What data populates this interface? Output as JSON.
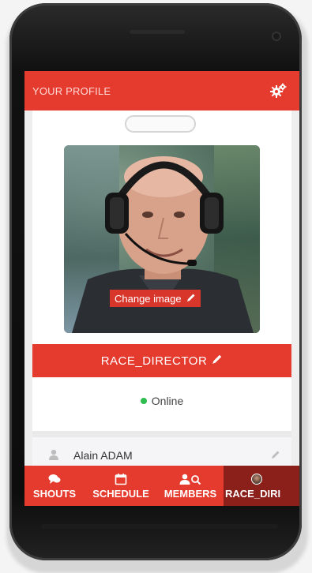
{
  "header": {
    "title": "YOUR PROFILE",
    "settings_icon": "gears-icon"
  },
  "profile": {
    "change_image_label": "Change image",
    "username": "RACE_DIRECTOR",
    "status": "Online",
    "status_color": "#2ebd4e",
    "full_name": "Alain ADAM"
  },
  "tabs": [
    {
      "label": "SHOUTS",
      "icon": "comments-icon"
    },
    {
      "label": "SCHEDULE",
      "icon": "calendar-icon"
    },
    {
      "label": "MEMBERS",
      "icon": "user-search-icon"
    },
    {
      "label": "RACE_DIRI",
      "icon": "avatar-icon"
    }
  ],
  "colors": {
    "accent": "#e53a2e",
    "active_tab": "#8b1f1a"
  }
}
